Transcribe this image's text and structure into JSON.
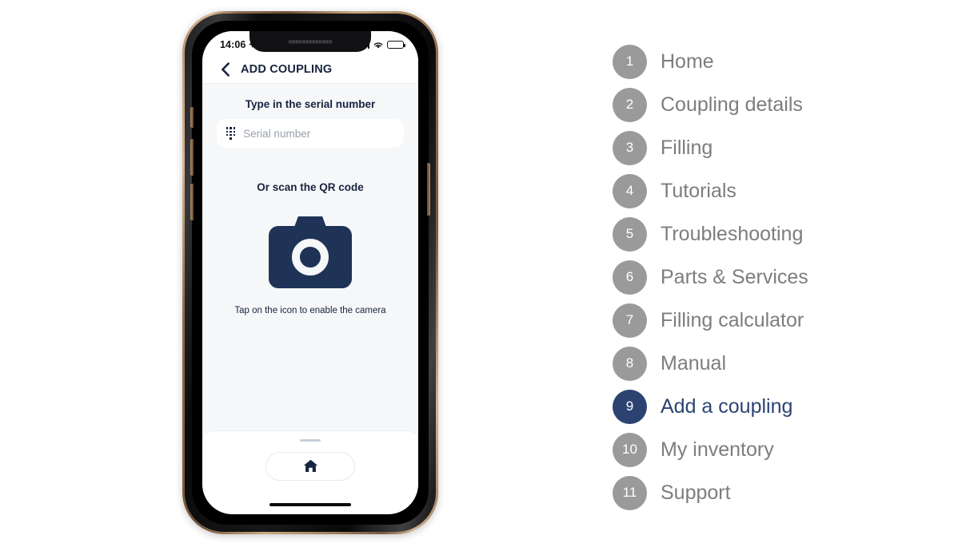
{
  "phone": {
    "status_bar": {
      "time": "14:06",
      "location_icon": "location-arrow-icon",
      "signal_icon": "cellular-signal-icon",
      "wifi_icon": "wifi-icon",
      "battery_icon": "battery-icon"
    },
    "nav": {
      "back_icon": "chevron-left-icon",
      "title": "ADD COUPLING"
    },
    "content": {
      "serial_heading": "Type in the serial number",
      "serial_placeholder": "Serial number",
      "serial_value": "",
      "keypad_icon": "keypad-dots-icon",
      "qr_heading": "Or scan the QR code",
      "camera_icon": "camera-icon",
      "camera_caption": "Tap on the icon to enable the camera"
    },
    "bottom": {
      "handle": "sheet-drag-handle",
      "home_icon": "home-icon"
    }
  },
  "steps": [
    {
      "number": "1",
      "label": "Home",
      "active": false
    },
    {
      "number": "2",
      "label": "Coupling details",
      "active": false
    },
    {
      "number": "3",
      "label": "Filling",
      "active": false
    },
    {
      "number": "4",
      "label": "Tutorials",
      "active": false
    },
    {
      "number": "5",
      "label": "Troubleshooting",
      "active": false
    },
    {
      "number": "6",
      "label": "Parts & Services",
      "active": false
    },
    {
      "number": "7",
      "label": "Filling calculator",
      "active": false
    },
    {
      "number": "8",
      "label": "Manual",
      "active": false
    },
    {
      "number": "9",
      "label": "Add a coupling",
      "active": true
    },
    {
      "number": "10",
      "label": "My inventory",
      "active": false
    },
    {
      "number": "11",
      "label": "Support",
      "active": false
    }
  ],
  "colors": {
    "navy_dark": "#1e3356",
    "navy_text": "#17233f",
    "navy_accent": "#2c4372",
    "badge_gray": "#9a9a9a",
    "label_gray": "#7d7d7d",
    "screen_bg": "#f6f7f9"
  }
}
